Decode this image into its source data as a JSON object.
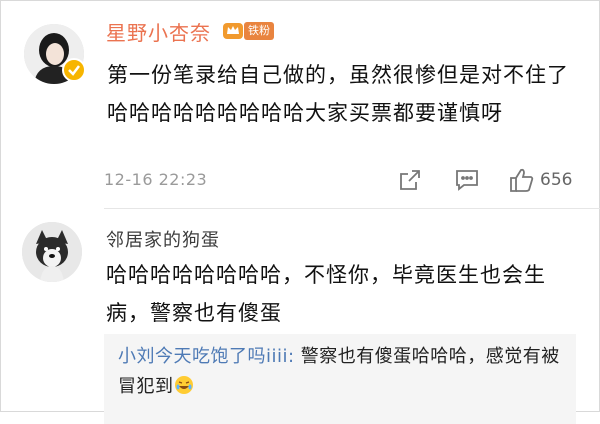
{
  "comment1": {
    "username": "星野小杏奈",
    "badge": "铁粉",
    "text": "第一份笔录给自己做的，虽然很惨但是对不住了哈哈哈哈哈哈哈哈哈大家买票都要谨慎呀",
    "timestamp": "12-16 22:23",
    "likes": "656",
    "name_color": "#eb7350"
  },
  "comment2": {
    "username": "邻居家的狗蛋",
    "text": "哈哈哈哈哈哈哈哈，不怪你，毕竟医生也会生病，警察也有傻蛋",
    "reply": {
      "user": "小刘今天吃饱了吗iiii:",
      "text": " 警察也有傻蛋哈哈哈，感觉有被冒犯到",
      "user_color": "#4e7ab5"
    }
  },
  "icons": {
    "share": "share-icon",
    "comment": "comment-icon",
    "like": "thumbs-up-icon",
    "verified": "verified-badge-icon",
    "emoji": "laughing-tears-emoji-icon"
  }
}
